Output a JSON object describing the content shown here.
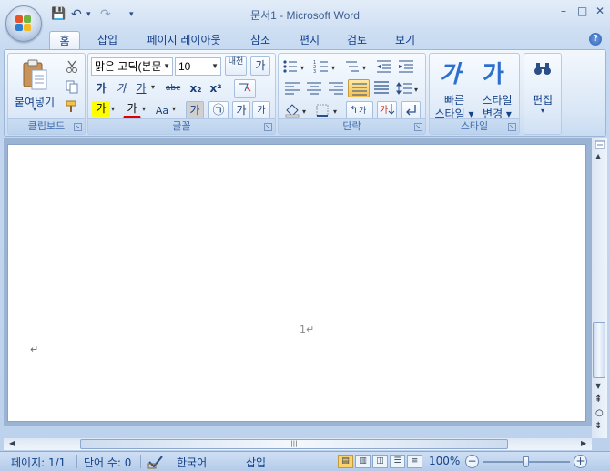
{
  "window": {
    "title": "문서1 - Microsoft Word",
    "minimize": "–",
    "maximize": "□",
    "close": "✕"
  },
  "qat": {
    "save": "💾",
    "undo": "↶",
    "undo_drop": "▾",
    "redo": "↷",
    "customize": "▾"
  },
  "tabs": [
    {
      "label": "홈"
    },
    {
      "label": "삽입"
    },
    {
      "label": "페이지 레이아웃"
    },
    {
      "label": "참조"
    },
    {
      "label": "편지"
    },
    {
      "label": "검토"
    },
    {
      "label": "보기"
    }
  ],
  "help": "?",
  "clipboard": {
    "label": "클립보드",
    "paste": "붙여넣기",
    "paste_drop": "▾"
  },
  "font": {
    "label": "글꼴",
    "family": "맑은 고딕(본문",
    "size": "10",
    "grow": "내천",
    "clear": "가",
    "bold": "가",
    "italic": "가",
    "underline": "가",
    "strike": "abc",
    "subscript": "x₂",
    "superscript": "x²",
    "change_case": "Aa",
    "highlight": "가",
    "color": "가",
    "shading": "가",
    "enclose": "㉠",
    "phonetic": "가",
    "bigger": "가",
    "pinyin": "가"
  },
  "paragraph": {
    "label": "단락"
  },
  "styles": {
    "label": "스타일",
    "quick": "빠른\n스타일",
    "quick_line1": "빠른",
    "quick_line2": "스타일 ▾",
    "change_line1": "스타일",
    "change_line2": "변경 ▾",
    "icon_quick": "가",
    "icon_change": "가"
  },
  "editing": {
    "label": "편집",
    "drop": "▾"
  },
  "document": {
    "page_number": "1",
    "paragraph_mark": "↵"
  },
  "status": {
    "page": "페이지: 1/1",
    "words": "단어 수: 0",
    "language": "한국어",
    "mode": "삽입",
    "zoom": "100%"
  },
  "scroll": {
    "grip": "|||"
  }
}
